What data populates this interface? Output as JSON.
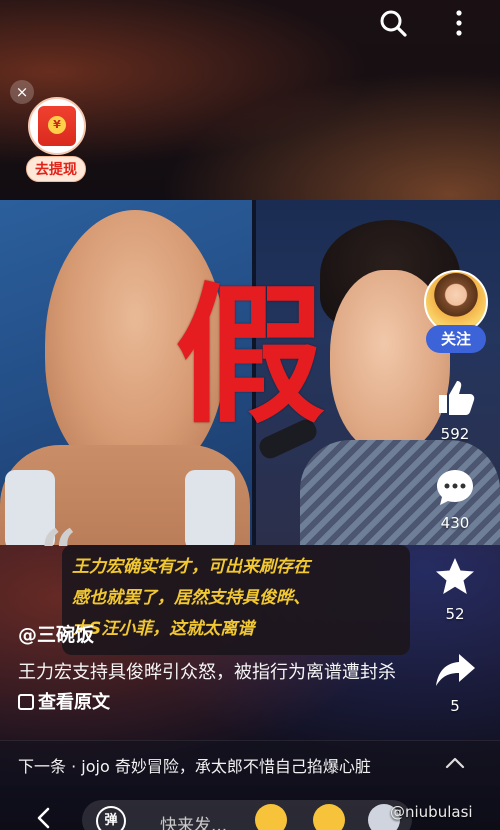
{
  "video": {
    "overlay_char": "假"
  },
  "red_packet": {
    "coin_symbol": "¥",
    "label": "去提现",
    "close_symbol": "×"
  },
  "actions": {
    "follow_label": "关注",
    "like_count": "592",
    "comment_count": "430",
    "favorite_count": "52",
    "share_count": "5"
  },
  "quote": {
    "mark": "“",
    "lines": [
      "王力宏确实有才，可出来刷存在",
      "感也就罢了，居然支持具俊晔、",
      "大S汪小菲，这就太离谱"
    ]
  },
  "post": {
    "author": "@三碗饭",
    "description": "王力宏支持具俊晔引众怒，被指行为离谱遭封杀",
    "link_label": "查看原文"
  },
  "next": {
    "text": "下一条 · jojo 奇妙冒险，承太郎不惜自己掐爆心脏"
  },
  "bottom": {
    "danmu_label": "弹",
    "input_placeholder": "快来发...",
    "watermark": "@niubulasi"
  },
  "colors": {
    "overlay_char": "#e61d20",
    "quote_text": "#f2c832",
    "follow_button": "#3d63d8",
    "favorite_star": "#ffffff"
  }
}
